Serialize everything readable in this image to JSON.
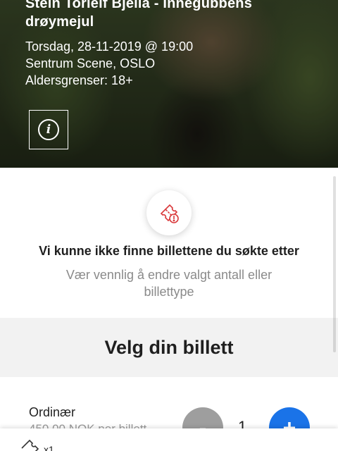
{
  "event": {
    "title": "Stein Torleif Bjella - Innegubbens drøymejul",
    "datetime": "Torsdag, 28-11-2019 @ 19:00",
    "venue": "Sentrum Scene, OSLO",
    "age_limit": "Aldersgrenser: 18+",
    "info_icon": "info-icon"
  },
  "empty_state": {
    "icon": "ticket-warning-icon",
    "title": "Vi kunne ikke finne billettene du søkte etter",
    "subtitle": "Vær vennlig å endre valgt antall eller billettype"
  },
  "ticket_section": {
    "title": "Velg din billett"
  },
  "ticket": {
    "name": "Ordinær",
    "price": "450,00 NOK per billett",
    "minus_label": "-",
    "quantity": "1",
    "plus_label": "+"
  },
  "cart": {
    "icon": "ticket-icon",
    "count": "x1"
  },
  "colors": {
    "accent_blue": "#1a73e8",
    "disabled_gray": "#9e9e9e",
    "warning_red": "#d9383a"
  }
}
